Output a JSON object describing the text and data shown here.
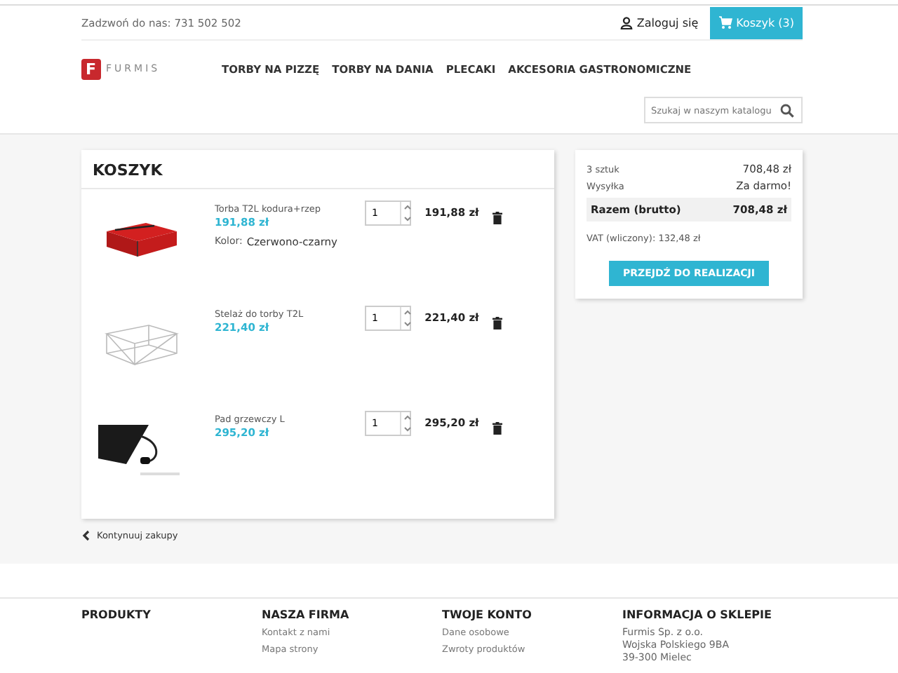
{
  "topbar": {
    "phone": "Zadzwoń do nas: 731 502 502",
    "login": "Zaloguj się",
    "cart_button": "Koszyk (3)"
  },
  "brand": {
    "logo_letter": "F",
    "logo_text": "FURMIS"
  },
  "nav": [
    "TORBY NA PIZZĘ",
    "TORBY NA DANIA",
    "PLECAKI",
    "AKCESORIA GASTRONOMICZNE"
  ],
  "search": {
    "placeholder": "Szukaj w naszym katalogu"
  },
  "cart": {
    "title": "KOSZYK",
    "items": [
      {
        "kind": "bag",
        "name": "Torba T2L kodura+rzep",
        "unit_price": "191,88 zł",
        "attribute": {
          "label": "Kolor:",
          "value": "Czerwono-czarny"
        },
        "quantity": "1",
        "total": "191,88 zł"
      },
      {
        "kind": "frame",
        "name": "Stelaż do torby T2L",
        "unit_price": "221,40 zł",
        "quantity": "1",
        "total": "221,40 zł"
      },
      {
        "kind": "pad",
        "name": "Pad grzewczy L",
        "unit_price": "295,20 zł",
        "quantity": "1",
        "total": "295,20 zł"
      }
    ],
    "continue_link": "Kontynuuj zakupy"
  },
  "summary": {
    "lines": [
      {
        "label": "3 sztuk",
        "value": "708,48 zł"
      },
      {
        "label": "Wysyłka",
        "value": "Za darmo!"
      }
    ],
    "total": {
      "label": "Razem (brutto)",
      "value": "708,48 zł"
    },
    "tax": "VAT (wliczony): 132,48 zł",
    "checkout_button": "PRZEJDŹ DO REALIZACJI"
  },
  "footer": [
    {
      "title": "PRODUKTY"
    },
    {
      "title": "NASZA FIRMA",
      "links": [
        "Kontakt z nami",
        "Mapa strony"
      ]
    },
    {
      "title": "TWOJE KONTO",
      "links": [
        "Dane osobowe",
        "Zwroty produktów"
      ]
    },
    {
      "title": "INFORMACJA O SKLEPIE",
      "address": [
        "Furmis Sp. z o.o.",
        "Wojska Polskiego 9BA",
        "39-300 Mielec"
      ]
    }
  ]
}
